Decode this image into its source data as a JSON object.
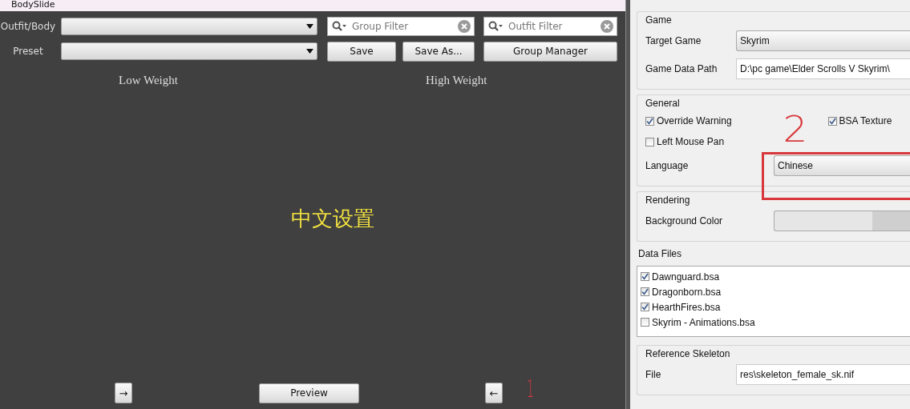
{
  "bodyslide": {
    "title": "BodySlide",
    "outfit_body": {
      "label": "Outfit/Body"
    },
    "preset": {
      "label": "Preset"
    },
    "group_filter": {
      "placeholder": "Group Filter"
    },
    "outfit_filter": {
      "placeholder": "Outfit Filter"
    },
    "buttons": [
      "Save",
      "Save As...",
      "Group Manager"
    ],
    "weight_labels": [
      "Low Weight",
      "High Weight"
    ],
    "caption": "中文设置",
    "bottom_buttons": [
      {
        "kind": "arrow",
        "label": "→"
      },
      {
        "kind": "wide",
        "label": "Preview"
      },
      {
        "kind": "arrow",
        "label": "←"
      }
    ]
  },
  "settings": {
    "groups": [
      {
        "title": "Game",
        "rows": [
          {
            "kind": "combo",
            "label": "Target Game",
            "value": "Skyrim"
          },
          {
            "kind": "field",
            "label": "Game Data Path",
            "value": "D:\\pc game\\Elder Scrolls V Skyrim\\"
          }
        ]
      },
      {
        "title": "General",
        "rows": [
          {
            "kind": "checks",
            "items": [
              {
                "label": "Override Warning",
                "checked": true
              },
              {
                "label": "BSA Texture",
                "checked": true
              }
            ]
          },
          {
            "kind": "checks",
            "items": [
              {
                "label": "Left Mouse Pan",
                "checked": false
              }
            ]
          },
          {
            "kind": "combo",
            "label": "Language",
            "value": "Chinese",
            "wide": true
          }
        ]
      },
      {
        "title": "Rendering",
        "rows": [
          {
            "kind": "color",
            "label": "Background Color",
            "wide": true
          }
        ]
      }
    ],
    "data_files": {
      "title": "Data Files",
      "items": [
        {
          "label": "Dawnguard.bsa",
          "checked": true
        },
        {
          "label": "Dragonborn.bsa",
          "checked": true
        },
        {
          "label": "HearthFires.bsa",
          "checked": true
        },
        {
          "label": "Skyrim - Animations.bsa",
          "checked": false
        }
      ]
    },
    "reference_skeleton": {
      "title": "Reference Skeleton",
      "rows": [
        {
          "kind": "field",
          "label": "File",
          "value": "res\\skeleton_female_sk.nif"
        }
      ]
    }
  },
  "annotations": [
    "1",
    "2"
  ]
}
